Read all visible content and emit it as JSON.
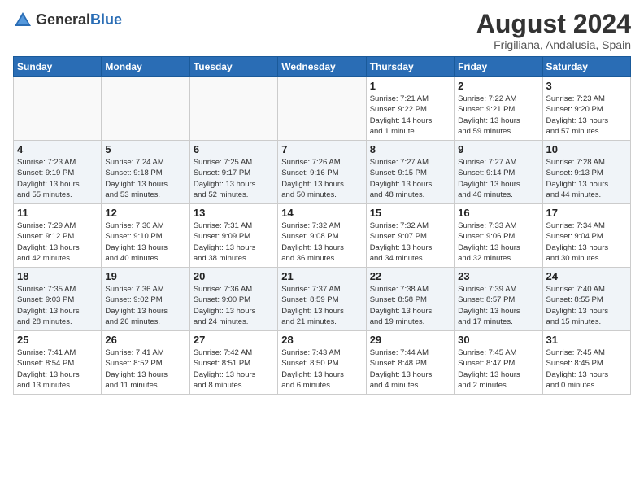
{
  "header": {
    "logo_general": "General",
    "logo_blue": "Blue",
    "month_year": "August 2024",
    "location": "Frigiliana, Andalusia, Spain"
  },
  "weekdays": [
    "Sunday",
    "Monday",
    "Tuesday",
    "Wednesday",
    "Thursday",
    "Friday",
    "Saturday"
  ],
  "weeks": [
    [
      {
        "day": "",
        "info": ""
      },
      {
        "day": "",
        "info": ""
      },
      {
        "day": "",
        "info": ""
      },
      {
        "day": "",
        "info": ""
      },
      {
        "day": "1",
        "info": "Sunrise: 7:21 AM\nSunset: 9:22 PM\nDaylight: 14 hours\nand 1 minute."
      },
      {
        "day": "2",
        "info": "Sunrise: 7:22 AM\nSunset: 9:21 PM\nDaylight: 13 hours\nand 59 minutes."
      },
      {
        "day": "3",
        "info": "Sunrise: 7:23 AM\nSunset: 9:20 PM\nDaylight: 13 hours\nand 57 minutes."
      }
    ],
    [
      {
        "day": "4",
        "info": "Sunrise: 7:23 AM\nSunset: 9:19 PM\nDaylight: 13 hours\nand 55 minutes."
      },
      {
        "day": "5",
        "info": "Sunrise: 7:24 AM\nSunset: 9:18 PM\nDaylight: 13 hours\nand 53 minutes."
      },
      {
        "day": "6",
        "info": "Sunrise: 7:25 AM\nSunset: 9:17 PM\nDaylight: 13 hours\nand 52 minutes."
      },
      {
        "day": "7",
        "info": "Sunrise: 7:26 AM\nSunset: 9:16 PM\nDaylight: 13 hours\nand 50 minutes."
      },
      {
        "day": "8",
        "info": "Sunrise: 7:27 AM\nSunset: 9:15 PM\nDaylight: 13 hours\nand 48 minutes."
      },
      {
        "day": "9",
        "info": "Sunrise: 7:27 AM\nSunset: 9:14 PM\nDaylight: 13 hours\nand 46 minutes."
      },
      {
        "day": "10",
        "info": "Sunrise: 7:28 AM\nSunset: 9:13 PM\nDaylight: 13 hours\nand 44 minutes."
      }
    ],
    [
      {
        "day": "11",
        "info": "Sunrise: 7:29 AM\nSunset: 9:12 PM\nDaylight: 13 hours\nand 42 minutes."
      },
      {
        "day": "12",
        "info": "Sunrise: 7:30 AM\nSunset: 9:10 PM\nDaylight: 13 hours\nand 40 minutes."
      },
      {
        "day": "13",
        "info": "Sunrise: 7:31 AM\nSunset: 9:09 PM\nDaylight: 13 hours\nand 38 minutes."
      },
      {
        "day": "14",
        "info": "Sunrise: 7:32 AM\nSunset: 9:08 PM\nDaylight: 13 hours\nand 36 minutes."
      },
      {
        "day": "15",
        "info": "Sunrise: 7:32 AM\nSunset: 9:07 PM\nDaylight: 13 hours\nand 34 minutes."
      },
      {
        "day": "16",
        "info": "Sunrise: 7:33 AM\nSunset: 9:06 PM\nDaylight: 13 hours\nand 32 minutes."
      },
      {
        "day": "17",
        "info": "Sunrise: 7:34 AM\nSunset: 9:04 PM\nDaylight: 13 hours\nand 30 minutes."
      }
    ],
    [
      {
        "day": "18",
        "info": "Sunrise: 7:35 AM\nSunset: 9:03 PM\nDaylight: 13 hours\nand 28 minutes."
      },
      {
        "day": "19",
        "info": "Sunrise: 7:36 AM\nSunset: 9:02 PM\nDaylight: 13 hours\nand 26 minutes."
      },
      {
        "day": "20",
        "info": "Sunrise: 7:36 AM\nSunset: 9:00 PM\nDaylight: 13 hours\nand 24 minutes."
      },
      {
        "day": "21",
        "info": "Sunrise: 7:37 AM\nSunset: 8:59 PM\nDaylight: 13 hours\nand 21 minutes."
      },
      {
        "day": "22",
        "info": "Sunrise: 7:38 AM\nSunset: 8:58 PM\nDaylight: 13 hours\nand 19 minutes."
      },
      {
        "day": "23",
        "info": "Sunrise: 7:39 AM\nSunset: 8:57 PM\nDaylight: 13 hours\nand 17 minutes."
      },
      {
        "day": "24",
        "info": "Sunrise: 7:40 AM\nSunset: 8:55 PM\nDaylight: 13 hours\nand 15 minutes."
      }
    ],
    [
      {
        "day": "25",
        "info": "Sunrise: 7:41 AM\nSunset: 8:54 PM\nDaylight: 13 hours\nand 13 minutes."
      },
      {
        "day": "26",
        "info": "Sunrise: 7:41 AM\nSunset: 8:52 PM\nDaylight: 13 hours\nand 11 minutes."
      },
      {
        "day": "27",
        "info": "Sunrise: 7:42 AM\nSunset: 8:51 PM\nDaylight: 13 hours\nand 8 minutes."
      },
      {
        "day": "28",
        "info": "Sunrise: 7:43 AM\nSunset: 8:50 PM\nDaylight: 13 hours\nand 6 minutes."
      },
      {
        "day": "29",
        "info": "Sunrise: 7:44 AM\nSunset: 8:48 PM\nDaylight: 13 hours\nand 4 minutes."
      },
      {
        "day": "30",
        "info": "Sunrise: 7:45 AM\nSunset: 8:47 PM\nDaylight: 13 hours\nand 2 minutes."
      },
      {
        "day": "31",
        "info": "Sunrise: 7:45 AM\nSunset: 8:45 PM\nDaylight: 13 hours\nand 0 minutes."
      }
    ]
  ]
}
